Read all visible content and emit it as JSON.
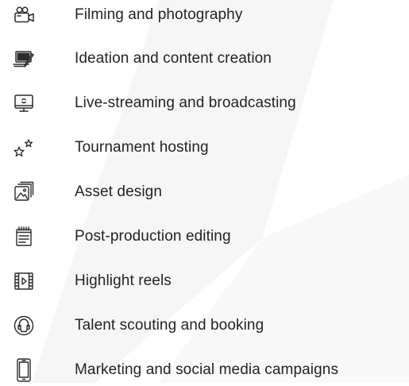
{
  "colors": {
    "text": "#232323",
    "icon": "#2b2b2b",
    "background": "#ffffff",
    "watermark": "#f6f6f7"
  },
  "services": [
    {
      "icon": "film-camera-icon",
      "label": "Filming and photography"
    },
    {
      "icon": "laptop-pen-icon",
      "label": "Ideation and content creation"
    },
    {
      "icon": "monitor-broadcast-icon",
      "label": "Live-streaming and broadcasting"
    },
    {
      "icon": "stars-icon",
      "label": "Tournament hosting"
    },
    {
      "icon": "image-stack-icon",
      "label": "Asset design"
    },
    {
      "icon": "notepad-icon",
      "label": "Post-production editing"
    },
    {
      "icon": "film-reel-icon",
      "label": "Highlight reels"
    },
    {
      "icon": "headset-icon",
      "label": "Talent scouting and booking"
    },
    {
      "icon": "phone-icon",
      "label": "Marketing and social media campaigns"
    }
  ]
}
